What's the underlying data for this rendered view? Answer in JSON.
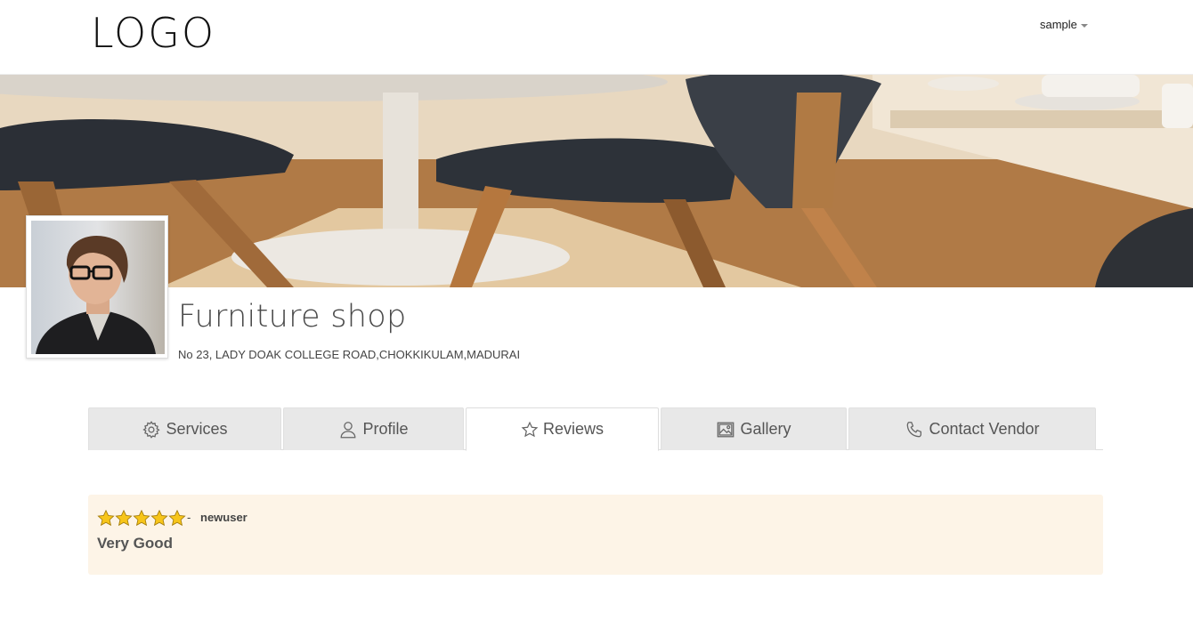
{
  "header": {
    "logo_text": "LOGO",
    "user_menu_label": "sample"
  },
  "shop": {
    "title": "Furniture shop",
    "address": "No 23, LADY DOAK COLLEGE ROAD,CHOKKIKULAM,MADURAI"
  },
  "tabs": [
    {
      "label": "Services",
      "icon": "gear-icon",
      "active": false
    },
    {
      "label": "Profile",
      "icon": "user-icon",
      "active": false
    },
    {
      "label": "Reviews",
      "icon": "star-icon",
      "active": true
    },
    {
      "label": "Gallery",
      "icon": "image-icon",
      "active": false
    },
    {
      "label": "Contact Vendor",
      "icon": "phone-icon",
      "active": false
    }
  ],
  "review": {
    "rating": 5,
    "rating_max": 5,
    "separator": "-",
    "reviewer": "newuser",
    "text": "Very Good"
  },
  "colors": {
    "review_background": "#fdf4e7",
    "tab_background": "#e8e8e8",
    "star_fill": "#f7c51a"
  }
}
